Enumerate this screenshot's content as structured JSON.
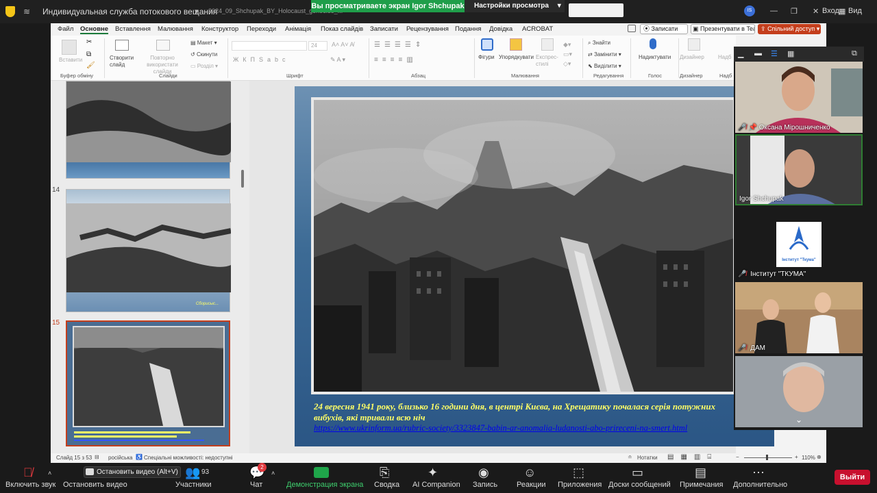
{
  "topbar": {
    "app_title": "Индивидуальная служба потокового вещания",
    "ppt_file": "2024_09_Shchupak_BY_Holocaust_genocide_...",
    "share_banner": "Вы просматриваете экран Igor Shchupak",
    "view_settings": "Настройки просмотра",
    "avatar_initials": "IS",
    "enter": "Вход",
    "view": "Вид"
  },
  "ppt": {
    "menu": [
      "Файл",
      "Основне",
      "Вставлення",
      "Малювання",
      "Конструктор",
      "Переходи",
      "Анімація",
      "Показ слайдів",
      "Записати",
      "Рецензування",
      "Подання",
      "Довідка",
      "ACROBAT"
    ],
    "active_menu": "Основне",
    "record": "Записати",
    "present_teams": "Презентувати в Teams",
    "share_access": "Спільний доступ",
    "ribbon": {
      "paste": "Вставити",
      "clipboard": "Буфер обміну",
      "new_slide": "Створити слайд",
      "reuse_slides": "Повторно використати слайди",
      "layout": "Макет",
      "reset": "Скинути",
      "sections": "Розділ",
      "slides": "Слайди",
      "font_size": "24",
      "font": "Шрифт",
      "paragraph": "Абзац",
      "shapes": "Фігури",
      "arrange": "Упорядкувати",
      "quick_styles": "Експрес-стилі",
      "drawing": "Малювання",
      "find": "Знайти",
      "replace": "Замінити",
      "select": "Виділити",
      "editing": "Редагування",
      "dictate": "Надиктувати",
      "voice": "Голос",
      "designer": "Дизайнер",
      "designer_group": "Дизайнер",
      "addins": "Надб"
    },
    "thumbs": [
      {
        "num": "14",
        "caption": "Сборисыс..."
      },
      {
        "num": "15",
        "caption": ""
      }
    ],
    "slide": {
      "text": "24 вересня 1941 року, близько 16 години дня, в центрі Києва, на Хрещатику почалася серія потужних вибухів, які тривали всю ніч",
      "link": "https://www.ukrinform.ua/rubric-society/3323847-babin-ar-anomalia-ludanosti-abo-prireceni-na-smert.html"
    },
    "status": {
      "slide_of": "Слайд 15 з 53",
      "language": "російська",
      "accessibility": "Спеціальні можливості: недоступні",
      "notes": "Нотатки",
      "zoom": "110%"
    }
  },
  "gallery": {
    "participants": [
      {
        "name": "Оксана Мірошниченко",
        "muted": true
      },
      {
        "name": "Igor Shchupak",
        "muted": false
      },
      {
        "name": "Інститут \"ТКУМА\"",
        "muted": true,
        "logo_text": "Інститут \"Ткума\""
      },
      {
        "name": "ДАМ",
        "muted": true
      },
      {
        "name": "",
        "muted": false
      }
    ]
  },
  "bottombar": {
    "unmute": "Включить звук",
    "stop_video": "Остановить видео",
    "stop_video_tip": "Остановить видео (Alt+V)",
    "participants": "Участники",
    "participants_count": "93",
    "chat": "Чат",
    "chat_badge": "2",
    "share_screen": "Демонстрация экрана",
    "summary": "Сводка",
    "ai": "AI Companion",
    "record": "Запись",
    "reactions": "Реакции",
    "apps": "Приложения",
    "whiteboards": "Доски сообщений",
    "notes": "Примечания",
    "more": "Дополнительно",
    "leave": "Выйти"
  },
  "colors": {
    "share_green": "#1f9e4a",
    "leave_red": "#c8102e",
    "ppt_accent": "#c43e1c",
    "slide_text": "#ffff66"
  }
}
